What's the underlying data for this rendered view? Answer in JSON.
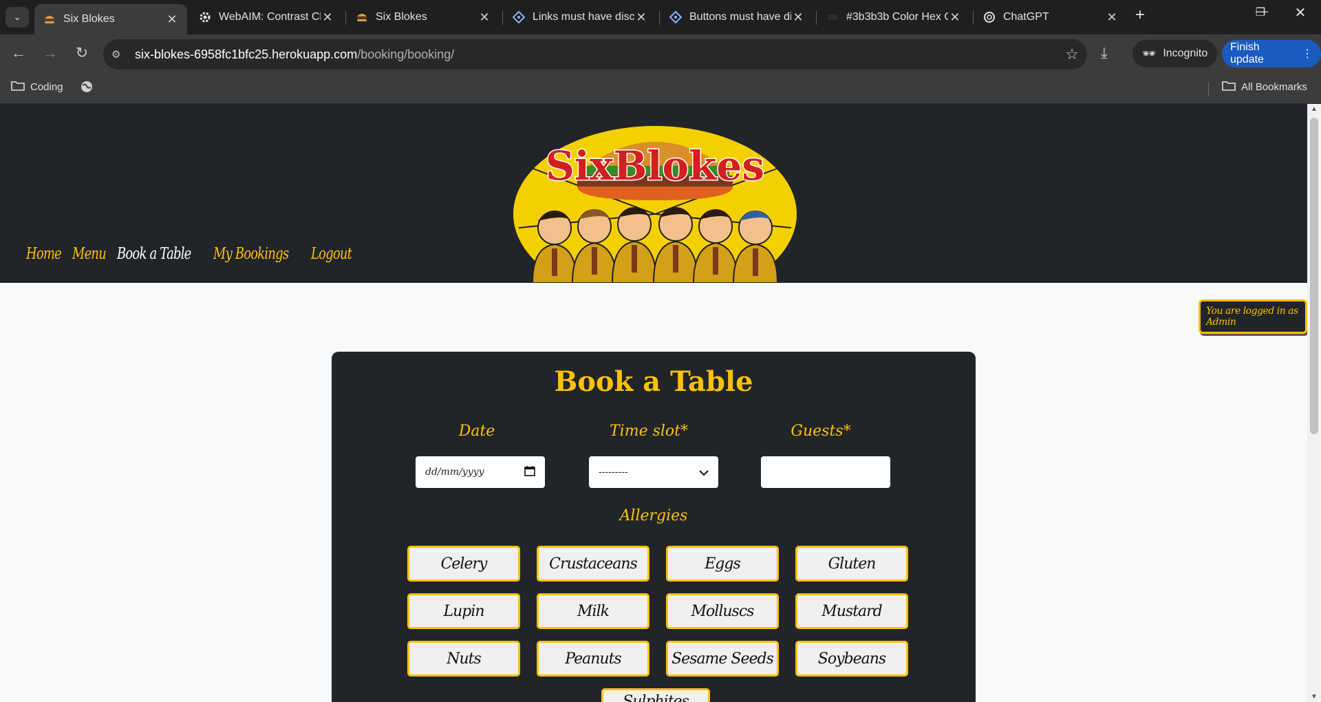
{
  "browser": {
    "tabs": [
      {
        "title": "Six Blokes",
        "favicon": "burger-icon"
      },
      {
        "title": "WebAIM: Contrast Ch",
        "favicon": "gear-icon"
      },
      {
        "title": "Six Blokes",
        "favicon": "burger-icon"
      },
      {
        "title": "Links must have disc",
        "favicon": "diamond-icon"
      },
      {
        "title": "Buttons must have di",
        "favicon": "diamond-icon"
      },
      {
        "title": "#3b3b3b Color Hex C",
        "favicon": "colorhex-icon"
      },
      {
        "title": "ChatGPT",
        "favicon": "chatgpt-icon"
      }
    ],
    "url_domain": "six-blokes-6958fc1bfc25.herokuapp.com",
    "url_path": "/booking/booking/",
    "incognito_label": "Incognito",
    "finish_update_label": "Finish update",
    "bookmarks": {
      "folder": "Coding",
      "all": "All Bookmarks"
    }
  },
  "site": {
    "logo_text": "SixBlokes",
    "nav": [
      {
        "label": "Home",
        "current": false
      },
      {
        "label": "Menu",
        "current": false
      },
      {
        "label": "Book a Table",
        "current": true
      },
      {
        "label": "My Bookings",
        "current": false
      },
      {
        "label": "Logout",
        "current": false
      }
    ],
    "logged_in_badge": "You are logged in as Admin"
  },
  "booking": {
    "title": "Book a Table",
    "date_label": "Date",
    "date_placeholder": "dd/mm/yyyy",
    "time_label": "Time slot*",
    "time_value": "---------",
    "guests_label": "Guests*",
    "guests_value": "",
    "allergies_label": "Allergies",
    "allergies": [
      "Celery",
      "Crustaceans",
      "Eggs",
      "Gluten",
      "Lupin",
      "Milk",
      "Molluscs",
      "Mustard",
      "Nuts",
      "Peanuts",
      "Sesame Seeds",
      "Soybeans",
      "Sulphites"
    ]
  },
  "colors": {
    "accent": "#ffc107",
    "dark": "#212529",
    "page_bg": "#f8f9fa"
  }
}
